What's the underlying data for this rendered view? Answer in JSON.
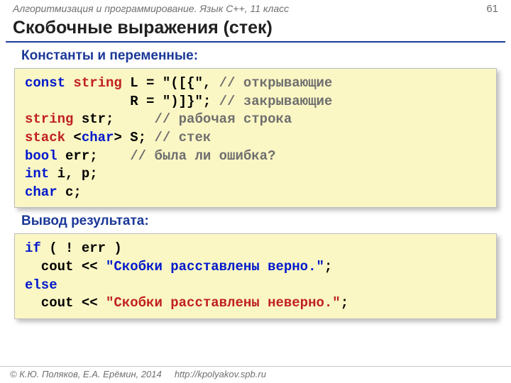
{
  "header": {
    "course": "Алгоритмизация и программирование. Язык С++, 11 класс",
    "page": "61"
  },
  "title": "Скобочные выражения (стек)",
  "sections": {
    "consts": "Константы и переменные:",
    "output": "Вывод результата:"
  },
  "code1": {
    "l1_kw1": "const ",
    "l1_kw2": "string ",
    "l1_txt": "L = \"([{\", ",
    "l1_cmt": "// открывающие",
    "l2_txt": "             R = \")]}\"; ",
    "l2_cmt": "// закрывающие",
    "l3_kw": "string ",
    "l3_txt": "str;     ",
    "l3_cmt": "// рабочая строка",
    "l4_kw1": "stack",
    "l4_txt1": " <",
    "l4_kw2": "char",
    "l4_txt2": "> S; ",
    "l4_cmt": "// стек",
    "l5_kw": "bool ",
    "l5_txt": "err;    ",
    "l5_cmt": "// была ли ошибка?",
    "l6_kw": "int ",
    "l6_txt": "i, p;",
    "l7_kw": "char ",
    "l7_txt": "c;"
  },
  "code2": {
    "l1_kw": "if",
    "l1_txt": " ( ! err )",
    "l2_txt1": "  cout << ",
    "l2_txt2": "\"Скобки расставлены верно.\"",
    "l2_txt3": ";",
    "l3_kw": "else",
    "l4_txt1": "  cout << ",
    "l4_txt2": "\"Скобки расставлены неверно.\"",
    "l4_txt3": ";"
  },
  "footer": {
    "authors": "© К.Ю. Поляков, Е.А. Ерёмин, 2014",
    "url": "http://kpolyakov.spb.ru"
  }
}
